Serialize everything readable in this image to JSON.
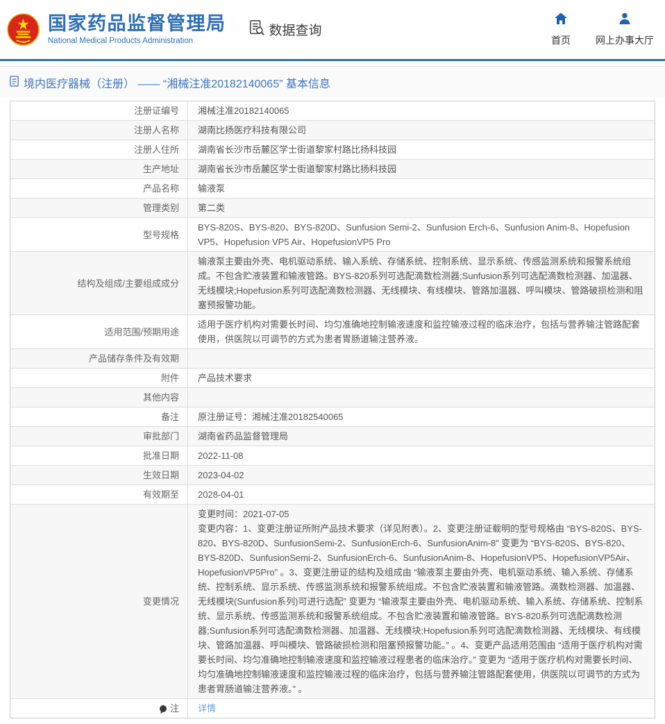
{
  "header": {
    "org_name_zh": "国家药品监督管理局",
    "org_name_en": "National Medical Products Administration",
    "data_query_label": "数据查询",
    "nav": {
      "home": "首页",
      "service_hall": "网上办事大厅"
    }
  },
  "page": {
    "title": "境内医疗器械（注册） —— “湘械注准20182140065” 基本信息"
  },
  "table": {
    "rows": [
      {
        "label": "注册证编号",
        "value": "湘械注准20182140065"
      },
      {
        "label": "注册人名称",
        "value": "湖南比扬医疗科技有限公司"
      },
      {
        "label": "注册人住所",
        "value": "湖南省长沙市岳麓区学士街道黎家村路比扬科技园"
      },
      {
        "label": "生产地址",
        "value": "湖南省长沙市岳麓区学士街道黎家村路比扬科技园"
      },
      {
        "label": "产品名称",
        "value": "输液泵"
      },
      {
        "label": "管理类别",
        "value": "第二类"
      },
      {
        "label": "型号规格",
        "value": "BYS-820S、BYS-820、BYS-820D、Sunfusion Semi-2、Sunfusion Erch-6、Sunfusion Anim-8、Hopefusion VP5、Hopefusion VP5 Air、HopefusionVP5 Pro"
      },
      {
        "label": "结构及组成/主要组成成分",
        "value": "输液泵主要由外壳、电机驱动系统、输入系统、存储系统、控制系统、显示系统、传感监测系统和报警系统组成。不包含贮液装置和输液管路。BYS-820系列可选配滴数检测器;Sunfusion系列可选配滴数检测器、加温器、无线模块;Hopefusion系列可选配滴数检测器、无线模块、有线模块、管路加温器、呼叫模块、管路破损检测和阻塞预报警功能。"
      },
      {
        "label": "适用范围/预期用途",
        "value": "适用于医疗机构对需要长时间、均匀准确地控制输液速度和监控输液过程的临床治疗，包括与营养输注管路配套使用，供医院以可调节的方式为患者胃肠道输注营养液。"
      },
      {
        "label": "产品储存条件及有效期",
        "value": ""
      },
      {
        "label": "附件",
        "value": "产品技术要求"
      },
      {
        "label": "其他内容",
        "value": ""
      },
      {
        "label": "备注",
        "value": "原注册证号：湘械注准20182540065"
      },
      {
        "label": "审批部门",
        "value": "湖南省药品监督管理局"
      },
      {
        "label": "批准日期",
        "value": "2022-11-08"
      },
      {
        "label": "生效日期",
        "value": "2023-04-02"
      },
      {
        "label": "有效期至",
        "value": "2028-04-01"
      },
      {
        "label": "变更情况",
        "value": "变更时间：2021-07-05\n变更内容：1、变更注册证所附产品技术要求（详见附表）。2、变更注册证载明的型号规格由 “BYS-820S、BYS-820、BYS-820D、SunfusionSemi-2、SunfusionErch-6、SunfusionAnim-8” 变更为 “BYS-820S、BYS-820、BYS-820D、SunfusionSemi-2、SunfusionErch-6、SunfusionAnim-8、HopefusionVP5、HopefusionVP5Air、HopefusionVP5Pro” 。3、变更注册证的结构及组成由 “输液泵主要由外壳、电机驱动系统、输入系统、存储系统、控制系统、显示系统、传感监测系统和报警系统组成。不包含贮液装置和输液管路。滴数检测器、加温器、无线模块(Sunfusion系列)可进行选配” 变更为 “输液泵主要由外壳、电机驱动系统、输入系统、存储系统、控制系统、显示系统、传感监测系统和报警系统组成。不包含贮液装置和输液管路。BYS-820系列可选配滴数检测器;Sunfusion系列可选配滴数检测器、加温器、无线模块;Hopefusion系列可选配滴数检测器、无线模块、有线模块、管路加温器、呼叫模块、管路破损检测和阻塞预报警功能。” 。4、变更产品适用范围由 “适用于医疗机构对需要长时间、均匀准确地控制输液速度和监控输液过程患者的临床治疗。” 变更为 “适用于医疗机构对需要长时间、均匀准确地控制输液速度和监控输液过程的临床治疗，包括与营养输注管路配套使用，供医院以可调节的方式为患者胃肠道输注营养液。” 。"
      }
    ],
    "note_row": {
      "label": "注",
      "link_label": "详情"
    }
  },
  "icons": {
    "emblem": "national-emblem",
    "data_query": "document-magnifier",
    "home": "house",
    "service_hall": "person",
    "page_title": "document",
    "note": "speech-balloon"
  },
  "colors": {
    "brand_blue": "#2e6fb5",
    "nav_icon_blue": "#1e62ae",
    "title_blue": "#3f76c0",
    "link_blue": "#6b9cd6",
    "row_alt_bg": "#f7f7f7",
    "table_border": "#d9d9d9",
    "header_divider": "#2e6fb5"
  }
}
